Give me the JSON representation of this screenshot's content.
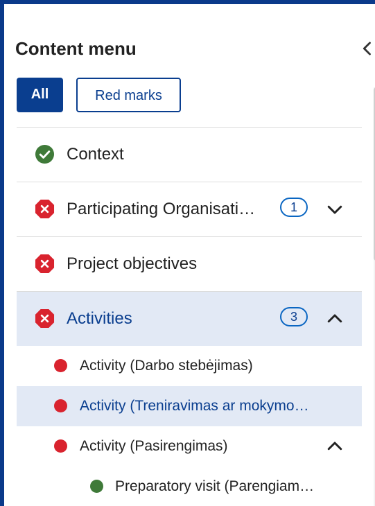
{
  "header": {
    "title": "Content menu",
    "collapse_icon": "chevron-left-icon"
  },
  "filters": {
    "all_label": "All",
    "red_marks_label": "Red marks"
  },
  "colors": {
    "primary": "#0a3e8f",
    "error": "#d9232e",
    "success": "#3f7a39",
    "active_bg": "#e2e9f5"
  },
  "menu": {
    "context": {
      "label": "Context",
      "status": "complete"
    },
    "participating": {
      "label": "Participating Organisati…",
      "status": "error",
      "count": "1",
      "expanded": false
    },
    "objectives": {
      "label": "Project objectives",
      "status": "error"
    },
    "activities": {
      "label": "Activities",
      "status": "error",
      "count": "3",
      "expanded": true
    },
    "sub": [
      {
        "label": "Activity (Darbo stebėjimas)",
        "status": "error"
      },
      {
        "label": "Activity (Treniravimas ar mokymo…",
        "status": "error",
        "active": true
      },
      {
        "label": "Activity (Pasirengimas)",
        "status": "error",
        "expanded": true
      }
    ],
    "subsub": [
      {
        "label": "Preparatory visit (Parengiam…",
        "status": "complete"
      }
    ]
  }
}
